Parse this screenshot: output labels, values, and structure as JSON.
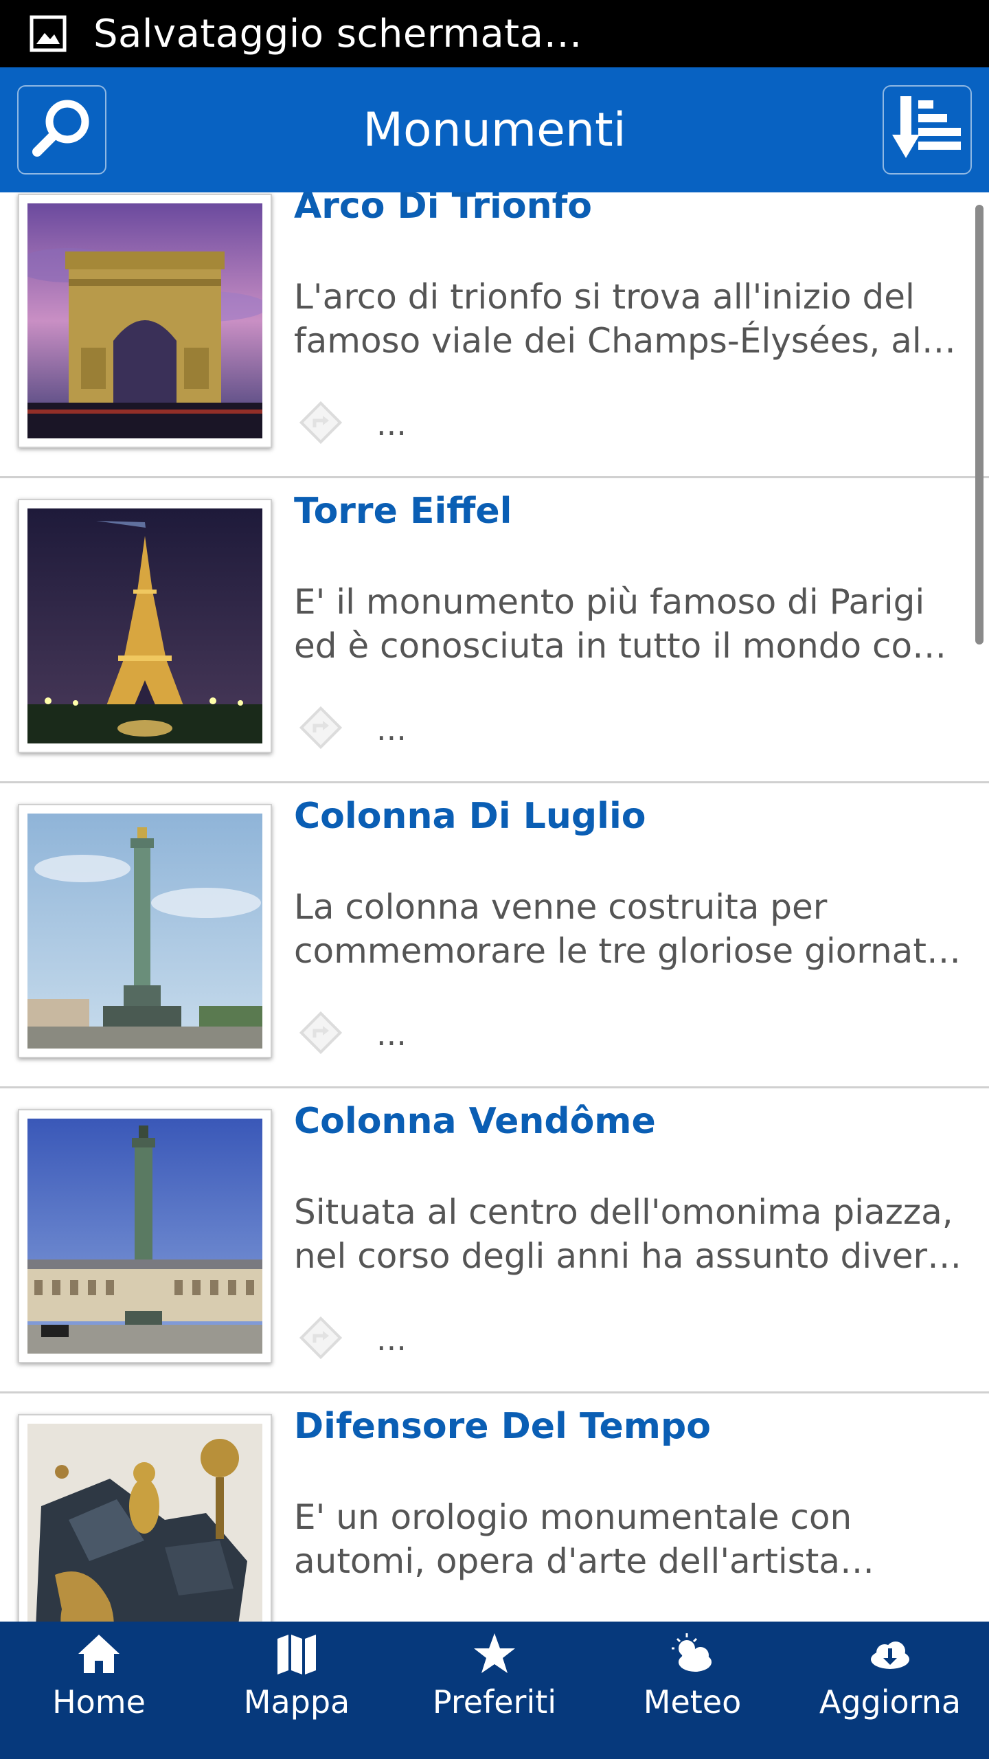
{
  "status_bar": {
    "text": "Salvataggio schermata…",
    "icon": "image-icon"
  },
  "header": {
    "title": "Monumenti",
    "search_icon": "search-icon",
    "sort_icon": "sort-down-icon",
    "background": "#0862c2"
  },
  "list": {
    "items": [
      {
        "title": "Arco Di Trionfo",
        "desc_line1": " L'arco di trionfo si trova all'inizio del",
        "desc_line2": "famoso viale dei Champs-Élysées, al…",
        "more": "..."
      },
      {
        "title": "Torre Eiffel",
        "desc_line1": " E' il monumento più famoso di Parigi",
        "desc_line2": "ed è conosciuta in tutto il mondo com…",
        "more": "..."
      },
      {
        "title": "Colonna Di Luglio",
        "desc_line1": " La colonna venne costruita per",
        "desc_line2": "commemorare le tre gloriose giornate…",
        "more": "..."
      },
      {
        "title": "Colonna Vendôme",
        "desc_line1": " Situata al centro dell'omonima piazza,",
        "desc_line2": "nel corso degli anni ha assunto diversi…",
        "more": "..."
      },
      {
        "title": "Difensore Del Tempo",
        "desc_line1": " E' un orologio monumentale con",
        "desc_line2": "automi, opera d'arte dell'artista…",
        "more": "..."
      }
    ]
  },
  "bottom_nav": {
    "items": [
      {
        "label": "Home",
        "icon": "home-icon"
      },
      {
        "label": "Mappa",
        "icon": "map-icon"
      },
      {
        "label": "Preferiti",
        "icon": "star-icon"
      },
      {
        "label": "Meteo",
        "icon": "weather-icon"
      },
      {
        "label": "Aggiorna",
        "icon": "cloud-download-icon"
      }
    ],
    "background": "#06397c"
  }
}
